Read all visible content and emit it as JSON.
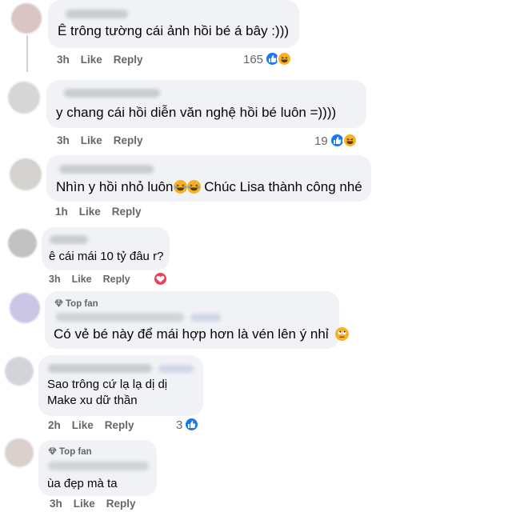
{
  "comments": [
    {
      "text": "Ê trông tường cái ảnh hồi bé á bây :)))",
      "time": "3h",
      "like_label": "Like",
      "reply_label": "Reply",
      "reaction_count": "165",
      "reactions": [
        "like-icon",
        "haha-icon"
      ]
    },
    {
      "text": "y chang cái hồi diễn văn nghệ hồi bé luôn =))))",
      "time": "3h",
      "like_label": "Like",
      "reply_label": "Reply",
      "reaction_count": "19",
      "reactions": [
        "like-icon",
        "haha-icon"
      ]
    },
    {
      "text_before": "Nhìn y hồi nhỏ luôn",
      "text_after": " Chúc Lisa thành công nhé",
      "time": "1h",
      "like_label": "Like",
      "reply_label": "Reply",
      "inline_emojis": [
        "laughing-tears-icon",
        "laughing-tears-icon"
      ]
    },
    {
      "text": "ê cái mái 10 tỷ đâu r?",
      "time": "3h",
      "like_label": "Like",
      "reply_label": "Reply",
      "reactions": [
        "love-icon"
      ]
    },
    {
      "badge": "Top fan",
      "text": "Có vẻ bé này để mái hợp hơn là vén lên ý nhỉ",
      "inline_emojis": [
        "rolling-eyes-icon"
      ]
    },
    {
      "text_line1": "Sao trông cứ lạ lạ dị dị",
      "text_line2": "Make xu dữ thần",
      "time": "2h",
      "like_label": "Like",
      "reply_label": "Reply",
      "reaction_count": "3",
      "reactions": [
        "like-icon"
      ]
    },
    {
      "badge": "Top fan",
      "text": "ùa đẹp mà ta",
      "time": "3h",
      "like_label": "Like",
      "reply_label": "Reply"
    }
  ],
  "colors": {
    "bubble": "#f0f2f5",
    "meta_text": "#65676b",
    "like_blue": "#1877f2",
    "haha_yellow": "#f7b125",
    "love_red": "#f33e58"
  }
}
